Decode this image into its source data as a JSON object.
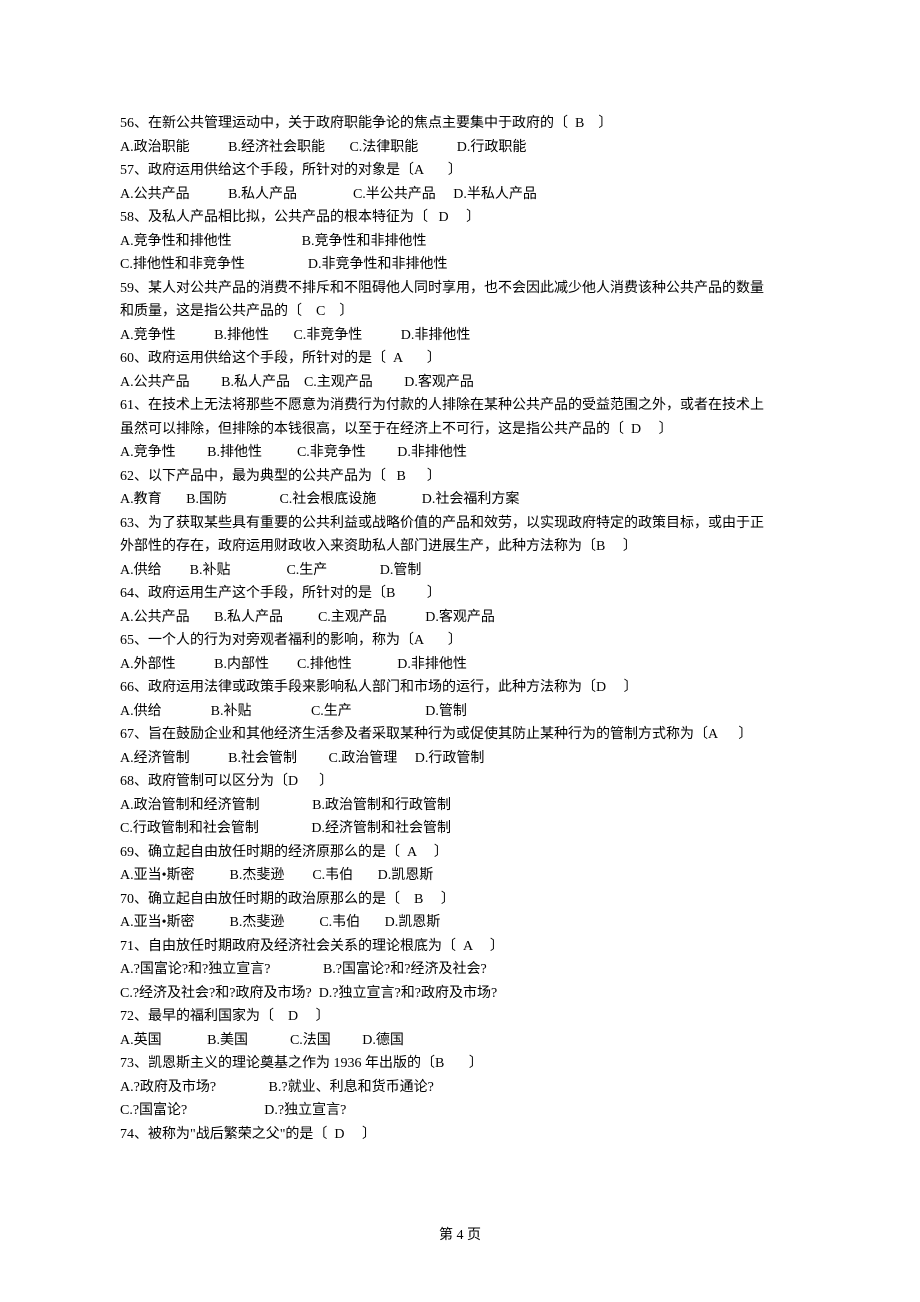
{
  "lines": [
    "56、在新公共管理运动中，关于政府职能争论的焦点主要集中于政府的〔  B    〕",
    "A.政治职能           B.经济社会职能       C.法律职能           D.行政职能",
    "57、政府运用供给这个手段，所针对的对象是〔A       〕",
    "A.公共产品           B.私人产品                C.半公共产品     D.半私人产品",
    "58、及私人产品相比拟，公共产品的根本特征为〔   D     〕",
    "A.竞争性和排他性                    B.竞争性和非排他性",
    "C.排他性和非竞争性                  D.非竞争性和非排他性",
    "59、某人对公共产品的消费不排斥和不阻碍他人同时享用，也不会因此减少他人消费该种公共产品的数量",
    "和质量，这是指公共产品的〔    C    〕",
    "A.竞争性           B.排他性       C.非竞争性           D.非排他性",
    "60、政府运用供给这个手段，所针对的是〔  A       〕",
    "A.公共产品         B.私人产品    C.主观产品         D.客观产品",
    "61、在技术上无法将那些不愿意为消费行为付款的人排除在某种公共产品的受益范围之外，或者在技术上",
    "虽然可以排除，但排除的本钱很高，以至于在经济上不可行，这是指公共产品的〔  D     〕",
    "A.竞争性         B.排他性          C.非竞争性         D.非排他性",
    "62、以下产品中，最为典型的公共产品为〔   B      〕",
    "A.教育       B.国防               C.社会根底设施             D.社会福利方案",
    "63、为了获取某些具有重要的公共利益或战略价值的产品和效劳，以实现政府特定的政策目标，或由于正",
    "外部性的存在，政府运用财政收入来资助私人部门进展生产，此种方法称为〔B     〕",
    "A.供给        B.补贴                C.生产               D.管制",
    "64、政府运用生产这个手段，所针对的是〔B         〕",
    "A.公共产品       B.私人产品          C.主观产品           D.客观产品",
    "65、一个人的行为对旁观者福利的影响，称为〔A       〕",
    "A.外部性           B.内部性        C.排他性             D.非排他性",
    "66、政府运用法律或政策手段来影响私人部门和市场的运行，此种方法称为〔D     〕",
    "A.供给              B.补贴                 C.生产                     D.管制",
    "67、旨在鼓励企业和其他经济生活参及者采取某种行为或促使其防止某种行为的管制方式称为〔A      〕",
    "A.经济管制           B.社会管制         C.政治管理     D.行政管制",
    "68、政府管制可以区分为〔D      〕",
    "A.政治管制和经济管制               B.政治管制和行政管制",
    "C.行政管制和社会管制               D.经济管制和社会管制",
    "69、确立起自由放任时期的经济原那么的是〔  A     〕",
    "A.亚当•斯密          B.杰斐逊        C.韦伯       D.凯恩斯",
    "70、确立起自由放任时期的政治原那么的是〔    B     〕",
    "A.亚当•斯密          B.杰斐逊          C.韦伯       D.凯恩斯",
    "71、自由放任时期政府及经济社会关系的理论根底为〔  A     〕",
    "A.?国富论?和?独立宣言?               B.?国富论?和?经济及社会?",
    "C.?经济及社会?和?政府及市场?  D.?独立宣言?和?政府及市场?",
    "72、最早的福利国家为〔    D     〕",
    "A.英国             B.美国            C.法国         D.德国",
    "73、凯恩斯主义的理论奠基之作为 1936 年出版的〔B       〕",
    "A.?政府及市场?               B.?就业、利息和货币通论?",
    "C.?国富论?                      D.?独立宣言?",
    "74、被称为\"战后繁荣之父\"的是〔  D     〕"
  ],
  "footer": "第 4 页"
}
